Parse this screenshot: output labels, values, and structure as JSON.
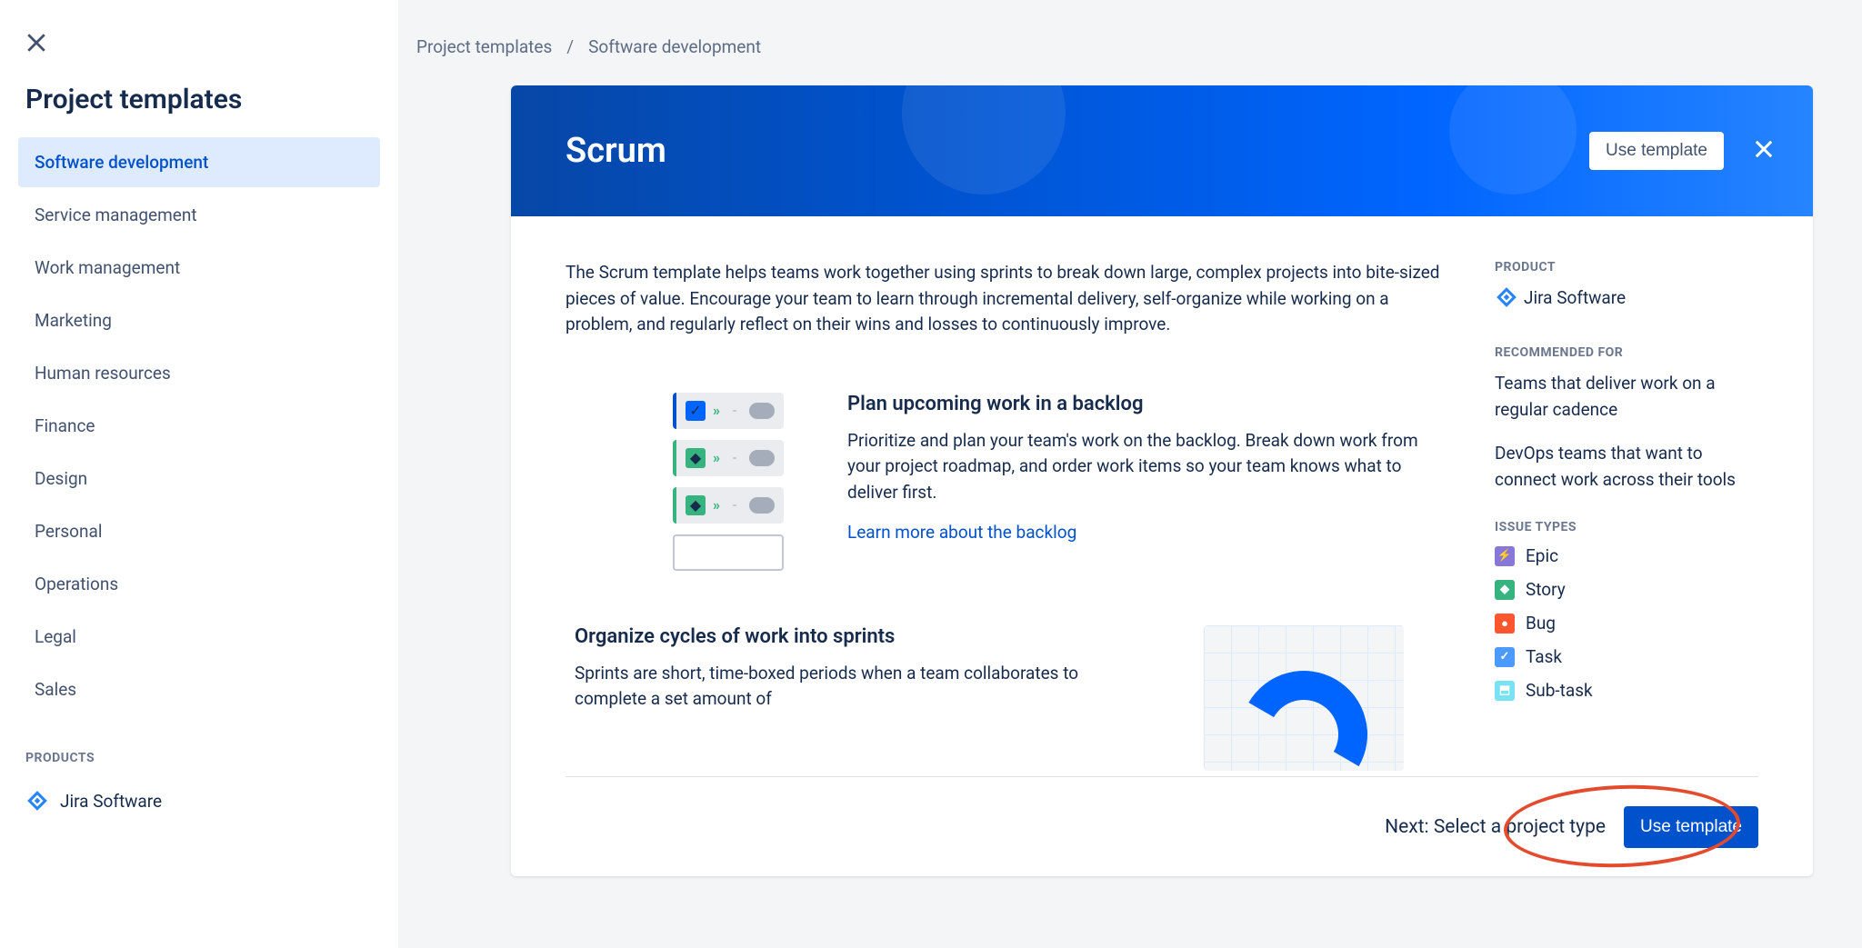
{
  "sidebar": {
    "title": "Project templates",
    "items": [
      {
        "label": "Software development",
        "active": true
      },
      {
        "label": "Service management"
      },
      {
        "label": "Work management"
      },
      {
        "label": "Marketing"
      },
      {
        "label": "Human resources"
      },
      {
        "label": "Finance"
      },
      {
        "label": "Design"
      },
      {
        "label": "Personal"
      },
      {
        "label": "Operations"
      },
      {
        "label": "Legal"
      },
      {
        "label": "Sales"
      }
    ],
    "products_label": "PRODUCTS",
    "product_jira": "Jira Software"
  },
  "breadcrumb": {
    "a": "Project templates",
    "b": "Software development"
  },
  "hero": {
    "title": "Scrum",
    "use_template": "Use template"
  },
  "intro": "The Scrum template helps teams work together using sprints to break down large, complex projects into bite-sized pieces of value. Encourage your team to learn through incremental delivery, self-organize while working on a problem, and regularly reflect on their wins and losses to continuously improve.",
  "feature1": {
    "title": "Plan upcoming work in a backlog",
    "body": "Prioritize and plan your team's work on the backlog. Break down work from your project roadmap, and order work items so your team knows what to deliver first.",
    "link": "Learn more about the backlog"
  },
  "feature2": {
    "title": "Organize cycles of work into sprints",
    "body": "Sprints are short, time-boxed periods when a team collaborates to complete a set amount of"
  },
  "meta": {
    "product_label": "PRODUCT",
    "product_name": "Jira Software",
    "rec_label": "RECOMMENDED FOR",
    "rec1": "Teams that deliver work on a regular cadence",
    "rec2": "DevOps teams that want to connect work across their tools",
    "issue_label": "ISSUE TYPES",
    "issues": {
      "epic": "Epic",
      "story": "Story",
      "bug": "Bug",
      "task": "Task",
      "subtask": "Sub-task"
    }
  },
  "footer": {
    "next": "Next: Select a project type",
    "use_template": "Use template"
  }
}
